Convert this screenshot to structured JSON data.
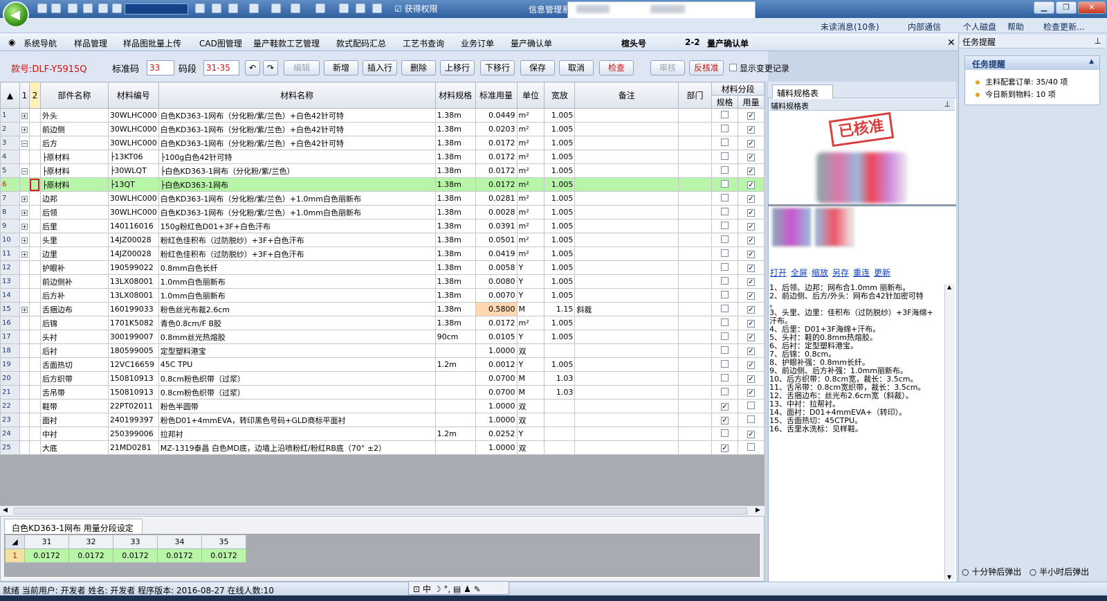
{
  "app": {
    "title": "信息管理系统",
    "perm_label": "获得权限"
  },
  "info_bar": {
    "unread": "未读消息(10条)",
    "internal": "内部通信",
    "disk": "个人磁盘",
    "help": "帮助",
    "update": "检查更新..."
  },
  "menu": [
    "系统导航",
    "样品管理",
    "样品图批量上传",
    "CAD图管理",
    "量产鞋款工艺管理",
    "款式配码汇总",
    "工艺书查询",
    "业务订单",
    "量产确认单"
  ],
  "active_tab": {
    "label": "楦头号",
    "suffix": "2-2",
    "title": "量产确认单"
  },
  "toolbar": {
    "style_no": "款号:DLF-Y5915Q",
    "std_code_label": "标准码",
    "std_code": "33",
    "size_range_label": "码段",
    "size_range": "31-35",
    "buttons": [
      "编辑",
      "新增",
      "插入行",
      "删除",
      "上移行",
      "下移行",
      "保存",
      "取消",
      "检查",
      "审核",
      "反核准"
    ],
    "show_changes": "显示变更记录"
  },
  "grid": {
    "col_headers": [
      "1",
      "2",
      "部件名称",
      "材料编号",
      "材料名称",
      "材料规格",
      "标准用量",
      "单位",
      "宽放",
      "备注",
      "部门",
      "材料分段",
      "规格",
      "用量"
    ],
    "rows": [
      {
        "n": "1",
        "exp": "+",
        "part": "外头",
        "code": "30WLHC000",
        "name": "白色KD363-1网布（分化粉/紫/兰色）+白色42针可特",
        "spec": "1.38m",
        "qty": "0.0449",
        "unit": "m²",
        "allow": "1.005",
        "note": "",
        "c1": false,
        "c2": true
      },
      {
        "n": "2",
        "exp": "+",
        "part": "前边侧",
        "code": "30WLHC000",
        "name": "白色KD363-1网布（分化粉/紫/兰色）+白色42针可特",
        "spec": "1.38m",
        "qty": "0.0203",
        "unit": "m²",
        "allow": "1.005",
        "note": "",
        "c1": false,
        "c2": true
      },
      {
        "n": "3",
        "exp": "−",
        "part": "后方",
        "code": "30WLHC000",
        "name": "白色KD363-1网布（分化粉/紫/兰色）+白色42针可特",
        "spec": "1.38m",
        "qty": "0.0172",
        "unit": "m²",
        "allow": "1.005",
        "note": "",
        "c1": false,
        "c2": true
      },
      {
        "n": "4",
        "exp": "",
        "part": "  ├原材料",
        "code": "├13KT06",
        "name": "  ├100g白色42针可特",
        "spec": "1.38m",
        "qty": "0.0172",
        "unit": "m²",
        "allow": "1.005",
        "note": "",
        "c1": false,
        "c2": true
      },
      {
        "n": "5",
        "exp": "−",
        "part": "  ├原材料",
        "code": "├30WLQT",
        "name": "  ├白色KD363-1网布（分化粉/紫/兰色）",
        "spec": "1.38m",
        "qty": "0.0172",
        "unit": "m²",
        "allow": "1.005",
        "note": "",
        "c1": false,
        "c2": true
      },
      {
        "n": "6",
        "exp": "",
        "part": "    ├原材料",
        "code": "├13QT",
        "name": "      ├白色KD363-1网布",
        "spec": "1.38m",
        "qty": "0.0172",
        "unit": "m²",
        "allow": "1.005",
        "note": "",
        "c1": false,
        "c2": true,
        "sel": true
      },
      {
        "n": "7",
        "exp": "+",
        "part": "边邦",
        "code": "30WLHC000",
        "name": "白色KD363-1网布（分化粉/紫/兰色）+1.0mm白色丽新布",
        "spec": "1.38m",
        "qty": "0.0281",
        "unit": "m²",
        "allow": "1.005",
        "note": "",
        "c1": false,
        "c2": true
      },
      {
        "n": "8",
        "exp": "+",
        "part": "后领",
        "code": "30WLHC000",
        "name": "白色KD363-1网布（分化粉/紫/兰色）+1.0mm白色丽新布",
        "spec": "1.38m",
        "qty": "0.0028",
        "unit": "m²",
        "allow": "1.005",
        "note": "",
        "c1": false,
        "c2": true
      },
      {
        "n": "9",
        "exp": "+",
        "part": "后里",
        "code": "140116016",
        "name": "150g粉红色D01+3F+白色汗布",
        "spec": "1.38m",
        "qty": "0.0391",
        "unit": "m²",
        "allow": "1.005",
        "note": "",
        "c1": false,
        "c2": true
      },
      {
        "n": "10",
        "exp": "+",
        "part": "头里",
        "code": "14JZ00028",
        "name": "粉红色佳积布（过防脱纱）+3F+白色汗布",
        "spec": "1.38m",
        "qty": "0.0501",
        "unit": "m²",
        "allow": "1.005",
        "note": "",
        "c1": false,
        "c2": true
      },
      {
        "n": "11",
        "exp": "+",
        "part": "边里",
        "code": "14JZ00028",
        "name": "粉红色佳积布（过防脱纱）+3F+白色汗布",
        "spec": "1.38m",
        "qty": "0.0419",
        "unit": "m²",
        "allow": "1.005",
        "note": "",
        "c1": false,
        "c2": true
      },
      {
        "n": "12",
        "exp": "",
        "part": "护眼补",
        "code": "190599022",
        "name": "0.8mm白色长纤",
        "spec": "1.38m",
        "qty": "0.0058",
        "unit": "Y",
        "allow": "1.005",
        "note": "",
        "c1": false,
        "c2": true
      },
      {
        "n": "13",
        "exp": "",
        "part": "前边侧补",
        "code": "13LX08001",
        "name": "1.0mm白色丽新布",
        "spec": "1.38m",
        "qty": "0.0080",
        "unit": "Y",
        "allow": "1.005",
        "note": "",
        "c1": false,
        "c2": true
      },
      {
        "n": "14",
        "exp": "",
        "part": "后方补",
        "code": "13LX08001",
        "name": "1.0mm白色丽新布",
        "spec": "1.38m",
        "qty": "0.0070",
        "unit": "Y",
        "allow": "1.005",
        "note": "",
        "c1": false,
        "c2": true
      },
      {
        "n": "15",
        "exp": "+",
        "part": "舌捆边布",
        "code": "160199033",
        "name": "粉色丝光布裁2.6cm",
        "spec": "1.38m",
        "qty": "0.5800",
        "unit": "M",
        "allow": "1.15",
        "note": "斜裁",
        "c1": false,
        "c2": true,
        "hl": true
      },
      {
        "n": "16",
        "exp": "",
        "part": "后锦",
        "code": "1701K5082",
        "name": "青色0.8cm/F B胶",
        "spec": "1.38m",
        "qty": "0.0172",
        "unit": "m²",
        "allow": "1.005",
        "note": "",
        "c1": false,
        "c2": true
      },
      {
        "n": "17",
        "exp": "",
        "part": "头衬",
        "code": "300199007",
        "name": "0.8mm丝光热熔胶",
        "spec": "90cm",
        "qty": "0.0105",
        "unit": "Y",
        "allow": "1.005",
        "note": "",
        "c1": false,
        "c2": true
      },
      {
        "n": "18",
        "exp": "",
        "part": "后衬",
        "code": "180599005",
        "name": "定型塑料港宝",
        "spec": "",
        "qty": "1.0000",
        "unit": "双",
        "allow": "",
        "note": "",
        "c1": false,
        "c2": true
      },
      {
        "n": "19",
        "exp": "",
        "part": "舌面热切",
        "code": "12VC16659",
        "name": "45C TPU",
        "spec": "1.2m",
        "qty": "0.0012",
        "unit": "Y",
        "allow": "1.005",
        "note": "",
        "c1": false,
        "c2": true
      },
      {
        "n": "20",
        "exp": "",
        "part": "后方织带",
        "code": "150810913",
        "name": "0.8cm粉色织带（过浆）",
        "spec": "",
        "qty": "0.0700",
        "unit": "M",
        "allow": "1.03",
        "note": "",
        "c1": false,
        "c2": true
      },
      {
        "n": "21",
        "exp": "",
        "part": "舌吊带",
        "code": "150810913",
        "name": "0.8cm粉色织带（过浆）",
        "spec": "",
        "qty": "0.0700",
        "unit": "M",
        "allow": "1.03",
        "note": "",
        "c1": false,
        "c2": true
      },
      {
        "n": "22",
        "exp": "",
        "part": "鞋带",
        "code": "22PT02011",
        "name": "粉色半圆带",
        "spec": "",
        "qty": "1.0000",
        "unit": "双",
        "allow": "",
        "note": "",
        "c1": true,
        "c2": false
      },
      {
        "n": "23",
        "exp": "",
        "part": "面衬",
        "code": "240199397",
        "name": "粉色D01+4mmEVA，转印黑色号码+GLD商标平面衬",
        "spec": "",
        "qty": "1.0000",
        "unit": "双",
        "allow": "",
        "note": "",
        "c1": true,
        "c2": false
      },
      {
        "n": "24",
        "exp": "",
        "part": "中衬",
        "code": "250399006",
        "name": "拉邦衬",
        "spec": "1.2m",
        "qty": "0.0252",
        "unit": "Y",
        "allow": "",
        "note": "",
        "c1": false,
        "c2": true
      },
      {
        "n": "25",
        "exp": "",
        "part": "大底",
        "code": "21MD0281",
        "name": "MZ-1319泰昌 白色MD底，边墙上沿喷粉红/粉红RB底（70° ±2）",
        "spec": "",
        "qty": "1.0000",
        "unit": "双",
        "allow": "",
        "note": "",
        "c1": true,
        "c2": false
      }
    ]
  },
  "bottom_tab": {
    "label": "白色KD363-1网布  用量分段设定"
  },
  "segments": {
    "row_no": "1",
    "sizes": [
      "31",
      "32",
      "33",
      "34",
      "35"
    ],
    "values": [
      "0.0172",
      "0.0172",
      "0.0172",
      "0.0172",
      "0.0172"
    ]
  },
  "right_panel": {
    "tab": "辅料规格表",
    "header": "辅料规格表",
    "stamp": "已核准",
    "links": [
      "打开",
      "全屏",
      "缩放",
      "另存",
      "重连",
      "更新"
    ],
    "notes": "1、后领、边邦：网布合1.0mm 丽新布。\n2、前边侧、后方/外头：网布合42针加密可特\n。\n3、头里、边里：佳积布（过防脱纱）+3F海绵+\n汗布。\n4、后里：D01+3F海绵+汗布。\n5、头衬：鞋的0.8mm热熔胶。\n6、后衬：定型塑料港宝。\n7、后锦：0.8cm。\n8、护眼补强：0.8mm长纤。\n9、前边侧、后方补强：1.0mm丽新布。\n10、后方织带：0.8cm宽，裁长：3.5cm。\n11、舌吊带：0.8cm宽织带，裁长：3.5cm。\n12、舌捆边布：丝光布2.6cm宽（斜裁）。\n13、中衬：拉帮衬。\n14、面衬：D01+4mmEVA+（转印）。\n15、舌面热切：45CTPU。\n16、舌里水洗标：见样鞋。"
  },
  "task_panel": {
    "header": "任务提醒",
    "box_title": "任务提醒",
    "items": [
      "主料配套订单: 35/40 项",
      "今日新到物料: 10 项"
    ],
    "radio1": "十分钟后弹出",
    "radio2": "半小时后弹出"
  },
  "status": {
    "text": "就绪  当前用户: 开发者  姓名: 开发者  程序版本: 2016-08-27  在线人数:10"
  },
  "ime": {
    "text": "中"
  }
}
